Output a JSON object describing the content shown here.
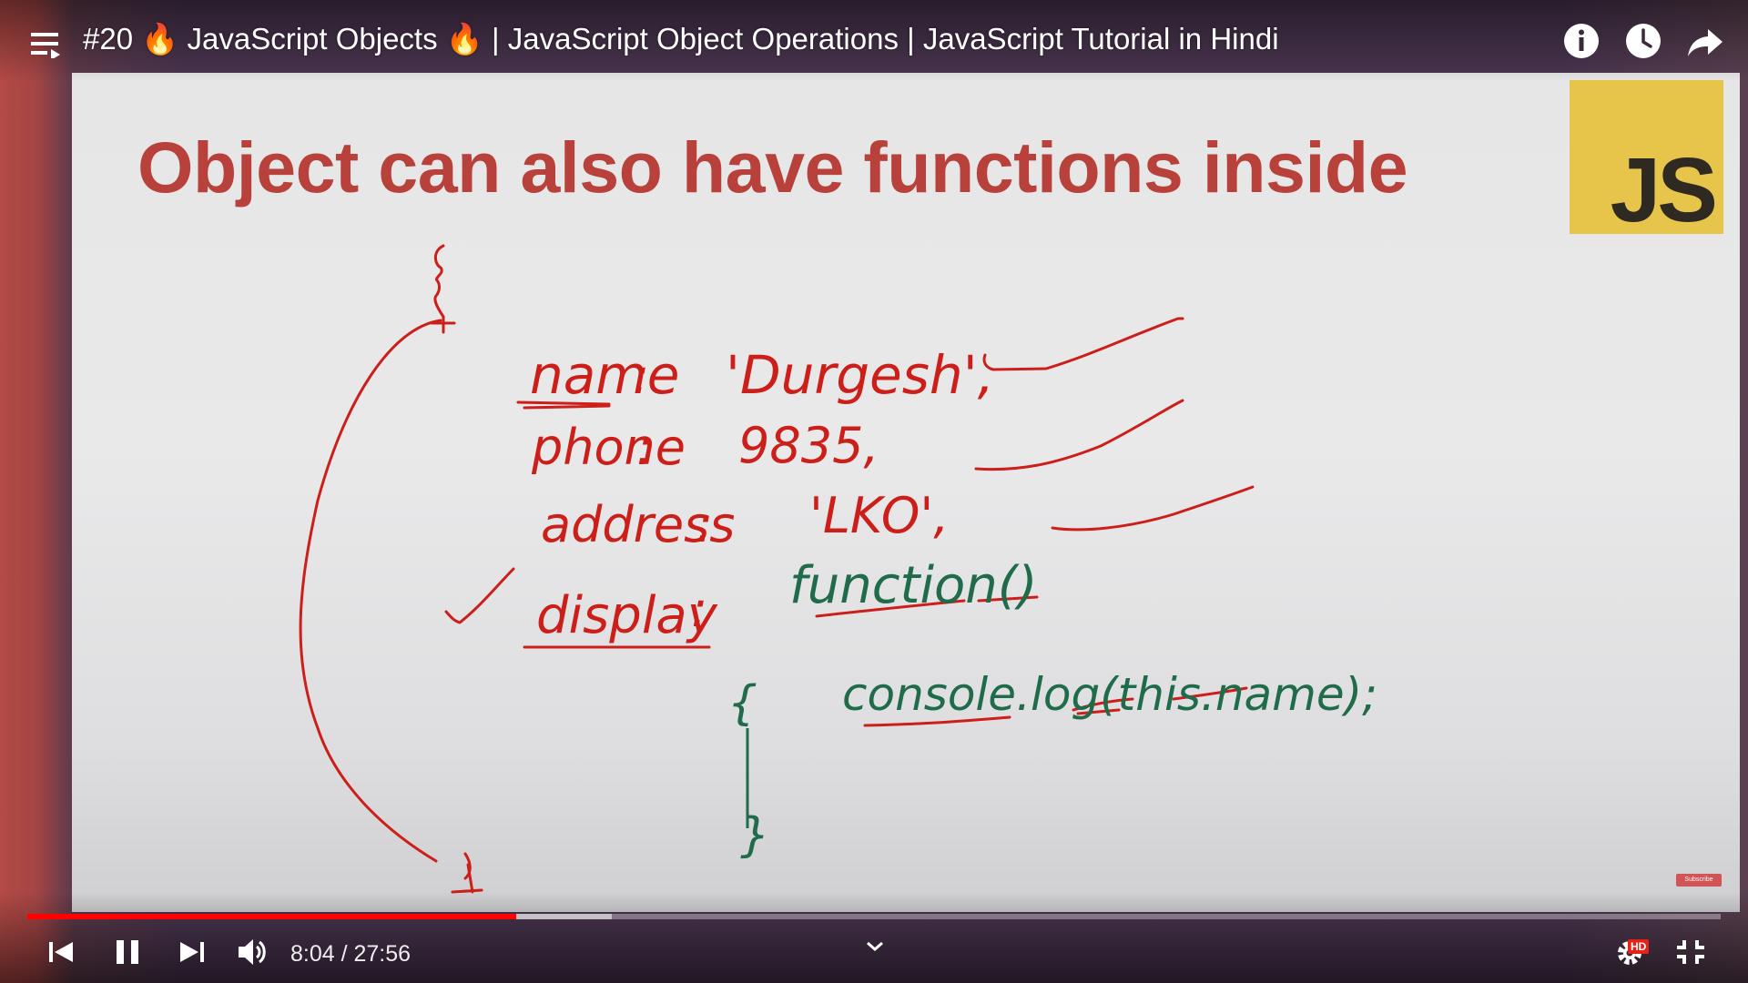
{
  "video": {
    "title": "#20 🔥 JavaScript Objects 🔥 | JavaScript Object Operations | JavaScript Tutorial in Hindi",
    "current_time": "8:04",
    "duration": "27:56",
    "time_display": "8:04 / 27:56",
    "progress_fraction": 0.2888,
    "buffered_fraction": 0.345,
    "quality_badge": "HD"
  },
  "slide": {
    "title": "Object can also have functions inside",
    "logo_text": "JS",
    "handwriting": {
      "line1_key": "name",
      "line1_value": "'Durgesh',",
      "line2_key": "phone",
      "line2_value": "9835,",
      "line3_key": "address",
      "line3_value": "'LKO',",
      "line4_key": "display",
      "line4_value": "function()",
      "body": "console.log(this.name);",
      "open_brace": "{",
      "close_brace": "}"
    },
    "watermark": "Subscribe"
  },
  "icons": {
    "menu": "playlist-menu-icon",
    "info": "info-icon",
    "watch_later": "clock-icon",
    "share": "share-icon",
    "prev": "skip-previous-icon",
    "pause": "pause-icon",
    "next": "skip-next-icon",
    "volume": "volume-icon",
    "settings": "gear-icon",
    "exit_fullscreen": "exit-fullscreen-icon",
    "chevron": "chevron-down-icon"
  },
  "colors": {
    "title_red": "#b8413c",
    "ink_red": "#cc1f1a",
    "ink_green": "#1f6b4a",
    "js_yellow": "#e6c54a",
    "progress_red": "#ff0000"
  }
}
